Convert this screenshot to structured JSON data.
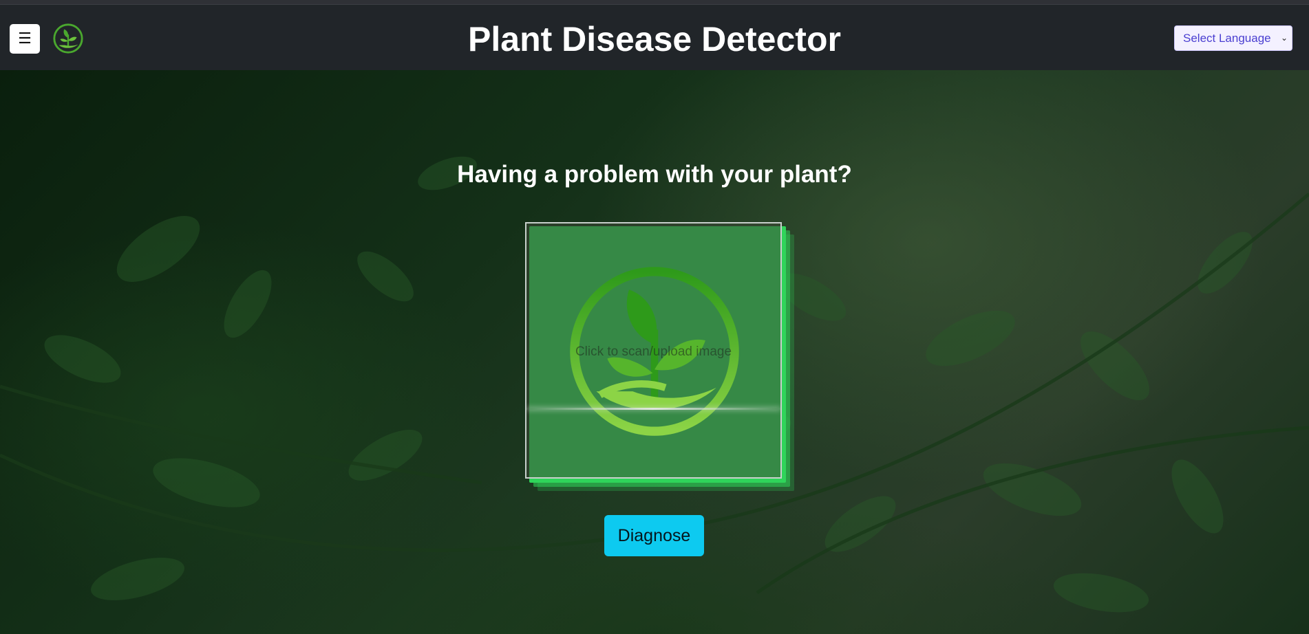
{
  "header": {
    "menu_icon": "☰",
    "title": "Plant Disease Detector",
    "language_select": {
      "selected": "Select Language",
      "caret": "⌄"
    }
  },
  "main": {
    "question": "Having a problem with your plant?",
    "scan_box": {
      "prompt": "Click to scan/upload image"
    },
    "diagnose_label": "Diagnose"
  },
  "icons": {
    "menu": "hamburger-menu-icon",
    "logo": "plant-hand-logo-icon",
    "scan_logo": "plant-hand-logo-icon"
  },
  "colors": {
    "header_bg": "#212529",
    "accent_green": "#2fd45a",
    "diagnose_bg": "#0dcaf0",
    "language_text": "#4a3fd1"
  }
}
